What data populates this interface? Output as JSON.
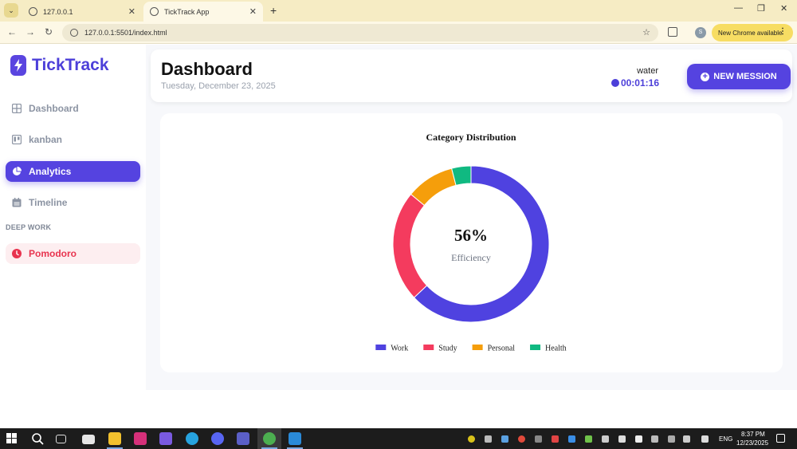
{
  "browser": {
    "tabs": [
      {
        "title": "127.0.0.1",
        "active": false
      },
      {
        "title": "TickTrack App",
        "active": true
      }
    ],
    "url": "127.0.0.1:5501/index.html",
    "profile_initial": "S",
    "update_label": "New Chrome available"
  },
  "app": {
    "brand": "TickTrack",
    "nav": [
      {
        "label": "Dashboard",
        "icon": "grid-icon",
        "active": false
      },
      {
        "label": "kanban",
        "icon": "kanban-icon",
        "active": false
      },
      {
        "label": "Analytics",
        "icon": "pie-chart-icon",
        "active": true
      },
      {
        "label": "Timeline",
        "icon": "calendar-icon",
        "active": false
      }
    ],
    "section_label": "DEEP WORK",
    "pomodoro_label": "Pomodoro",
    "colors": {
      "accent": "#5543e0",
      "pomodoro": "#e8344f"
    }
  },
  "header": {
    "title": "Dashboard",
    "date": "Tuesday, December 23, 2025",
    "active_task": "water",
    "timer": "00:01:16",
    "new_mission_label": "NEW MESSION"
  },
  "chart_data": {
    "type": "pie",
    "variant": "doughnut",
    "title": "Category Distribution",
    "center_value": "56%",
    "center_label": "Efficiency",
    "categories": [
      "Work",
      "Study",
      "Personal",
      "Health"
    ],
    "values": [
      63,
      23,
      10,
      4
    ],
    "colors": [
      "#4f42e0",
      "#f43b5e",
      "#f59e0b",
      "#10b981"
    ],
    "legend_position": "bottom"
  },
  "taskbar": {
    "time": "8:37 PM",
    "date": "12/23/2025",
    "language": "ENG"
  }
}
